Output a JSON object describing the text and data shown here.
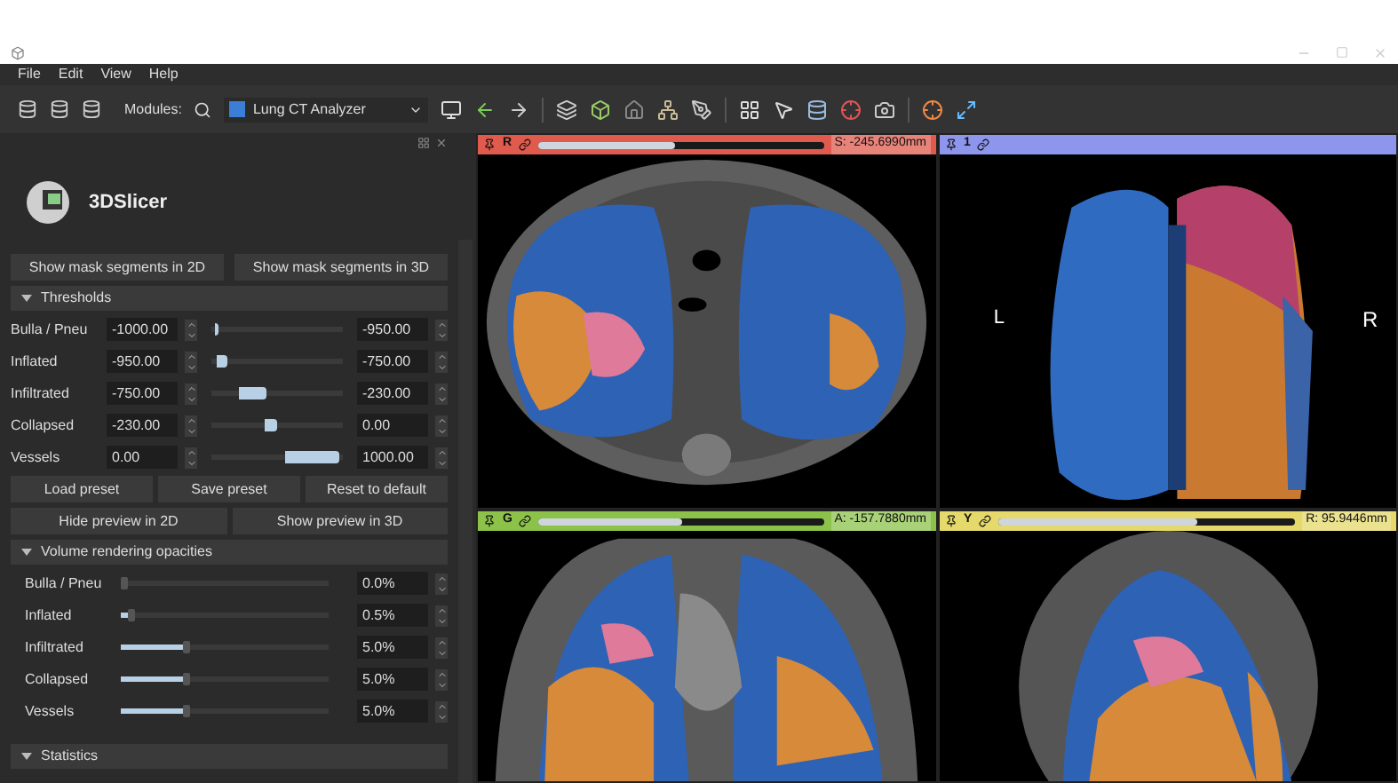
{
  "menu": [
    "File",
    "Edit",
    "View",
    "Help"
  ],
  "toolbar": {
    "modules_label": "Modules:",
    "module": "Lung CT Analyzer"
  },
  "logo": {
    "text": "3DSlicer"
  },
  "mask_buttons": [
    "Show mask segments in 2D",
    "Show mask segments in 3D"
  ],
  "thresholds": {
    "title": "Thresholds",
    "expanded": true,
    "rows": [
      {
        "label": "Bulla / Pneu",
        "min": "-1000.00",
        "max": "-950.00",
        "level": 0.06
      },
      {
        "label": "Inflated",
        "min": "-950.00",
        "max": "-750.00",
        "level": 0.12
      },
      {
        "label": "Infiltrated",
        "min": "-750.00",
        "max": "-230.00",
        "level": 0.42
      },
      {
        "label": "Collapsed",
        "min": "-230.00",
        "max": "0.00",
        "level": 0.5
      },
      {
        "label": "Vessels",
        "min": "0.00",
        "max": "1000.00",
        "level": 0.97
      }
    ]
  },
  "preset_buttons": [
    "Load preset",
    "Save preset",
    "Reset to default"
  ],
  "preview_buttons": [
    "Hide preview in 2D",
    "Show preview in 3D"
  ],
  "opacities": {
    "title": "Volume rendering opacities",
    "expanded": true,
    "rows": [
      {
        "label": "Bulla / Pneu",
        "level": 0.0,
        "value": "0.0%"
      },
      {
        "label": "Inflated",
        "level": 0.03,
        "value": "0.5%"
      },
      {
        "label": "Infiltrated",
        "level": 0.3,
        "value": "5.0%"
      },
      {
        "label": "Collapsed",
        "level": 0.3,
        "value": "5.0%"
      },
      {
        "label": "Vessels",
        "level": 0.3,
        "value": "5.0%"
      }
    ]
  },
  "statistics": {
    "title": "Statistics",
    "expanded": true
  },
  "views": [
    {
      "kind": "slice",
      "label": "R",
      "color": "#e05a4e",
      "level": 0.48,
      "reading": "S: -245.6990mm"
    },
    {
      "kind": "volume",
      "label": "1",
      "color": "#8e95ec",
      "left": "L",
      "right": "R"
    },
    {
      "kind": "slice",
      "label": "G",
      "color": "#8cc24a",
      "level": 0.5,
      "reading": "A: -157.7880mm"
    },
    {
      "kind": "slice",
      "label": "Y",
      "color": "#e4d96a",
      "level": 0.67,
      "reading": "R: 95.9446mm"
    }
  ]
}
